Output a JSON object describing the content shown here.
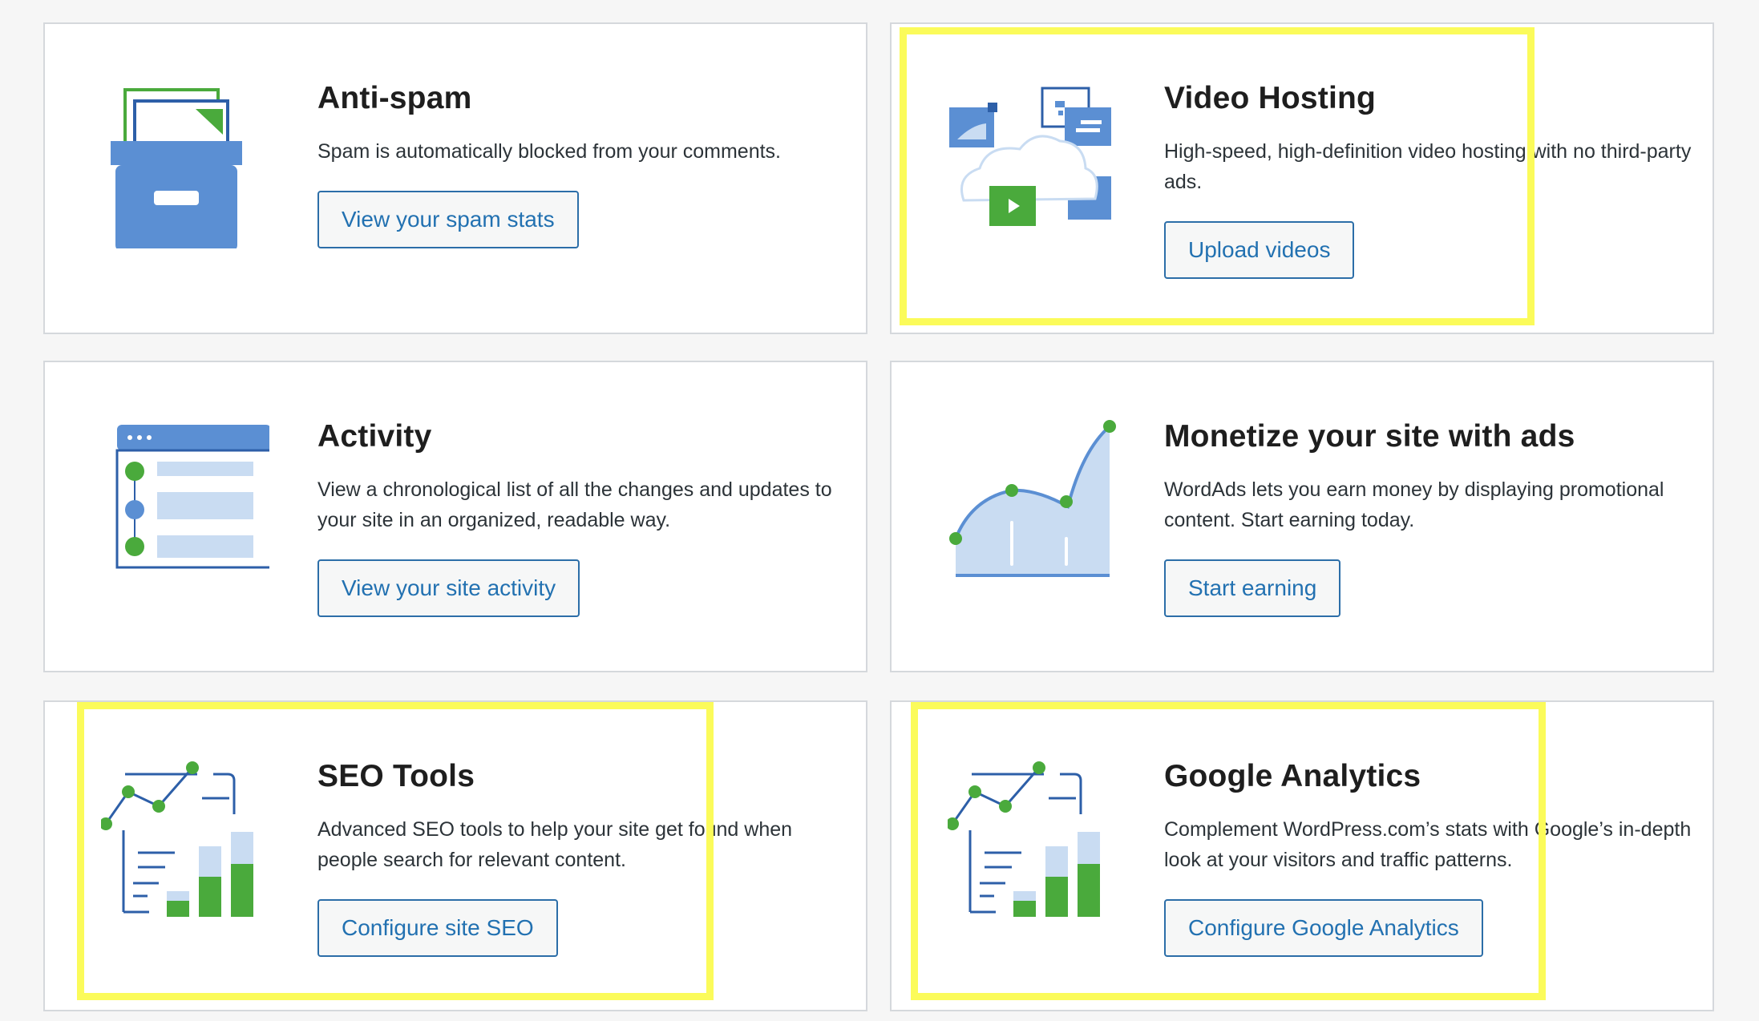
{
  "cards": [
    {
      "title": "Anti-spam",
      "description": "Spam is automatically blocked from your comments.",
      "button": "View your spam stats",
      "icon": "archive-box-icon"
    },
    {
      "title": "Video Hosting",
      "description": "High-speed, high-definition video hosting with no third-party ads.",
      "button": "Upload videos",
      "icon": "video-cloud-icon"
    },
    {
      "title": "Activity",
      "description": "View a chronological list of all the changes and updates to your site in an organized, readable way.",
      "button": "View your site activity",
      "icon": "activity-log-icon"
    },
    {
      "title": "Monetize your site with ads",
      "description": "WordAds lets you earn money by displaying promotional content. Start earning today.",
      "button": "Start earning",
      "icon": "earnings-chart-icon"
    },
    {
      "title": "SEO Tools",
      "description": "Advanced SEO tools to help your site get found when people search for relevant content.",
      "button": "Configure site SEO",
      "icon": "seo-stats-icon"
    },
    {
      "title": "Google Analytics",
      "description": "Complement WordPress.com’s stats with Google’s in-depth look at your visitors and traffic patterns.",
      "button": "Configure Google Analytics",
      "icon": "analytics-stats-icon"
    }
  ],
  "colors": {
    "blue": "#4f8fd6",
    "light_blue": "#c9dcf2",
    "dark_blue": "#2d5fa8",
    "green": "#4aaa3c",
    "button_text": "#2271b1",
    "highlight": "#fbfb5a"
  }
}
